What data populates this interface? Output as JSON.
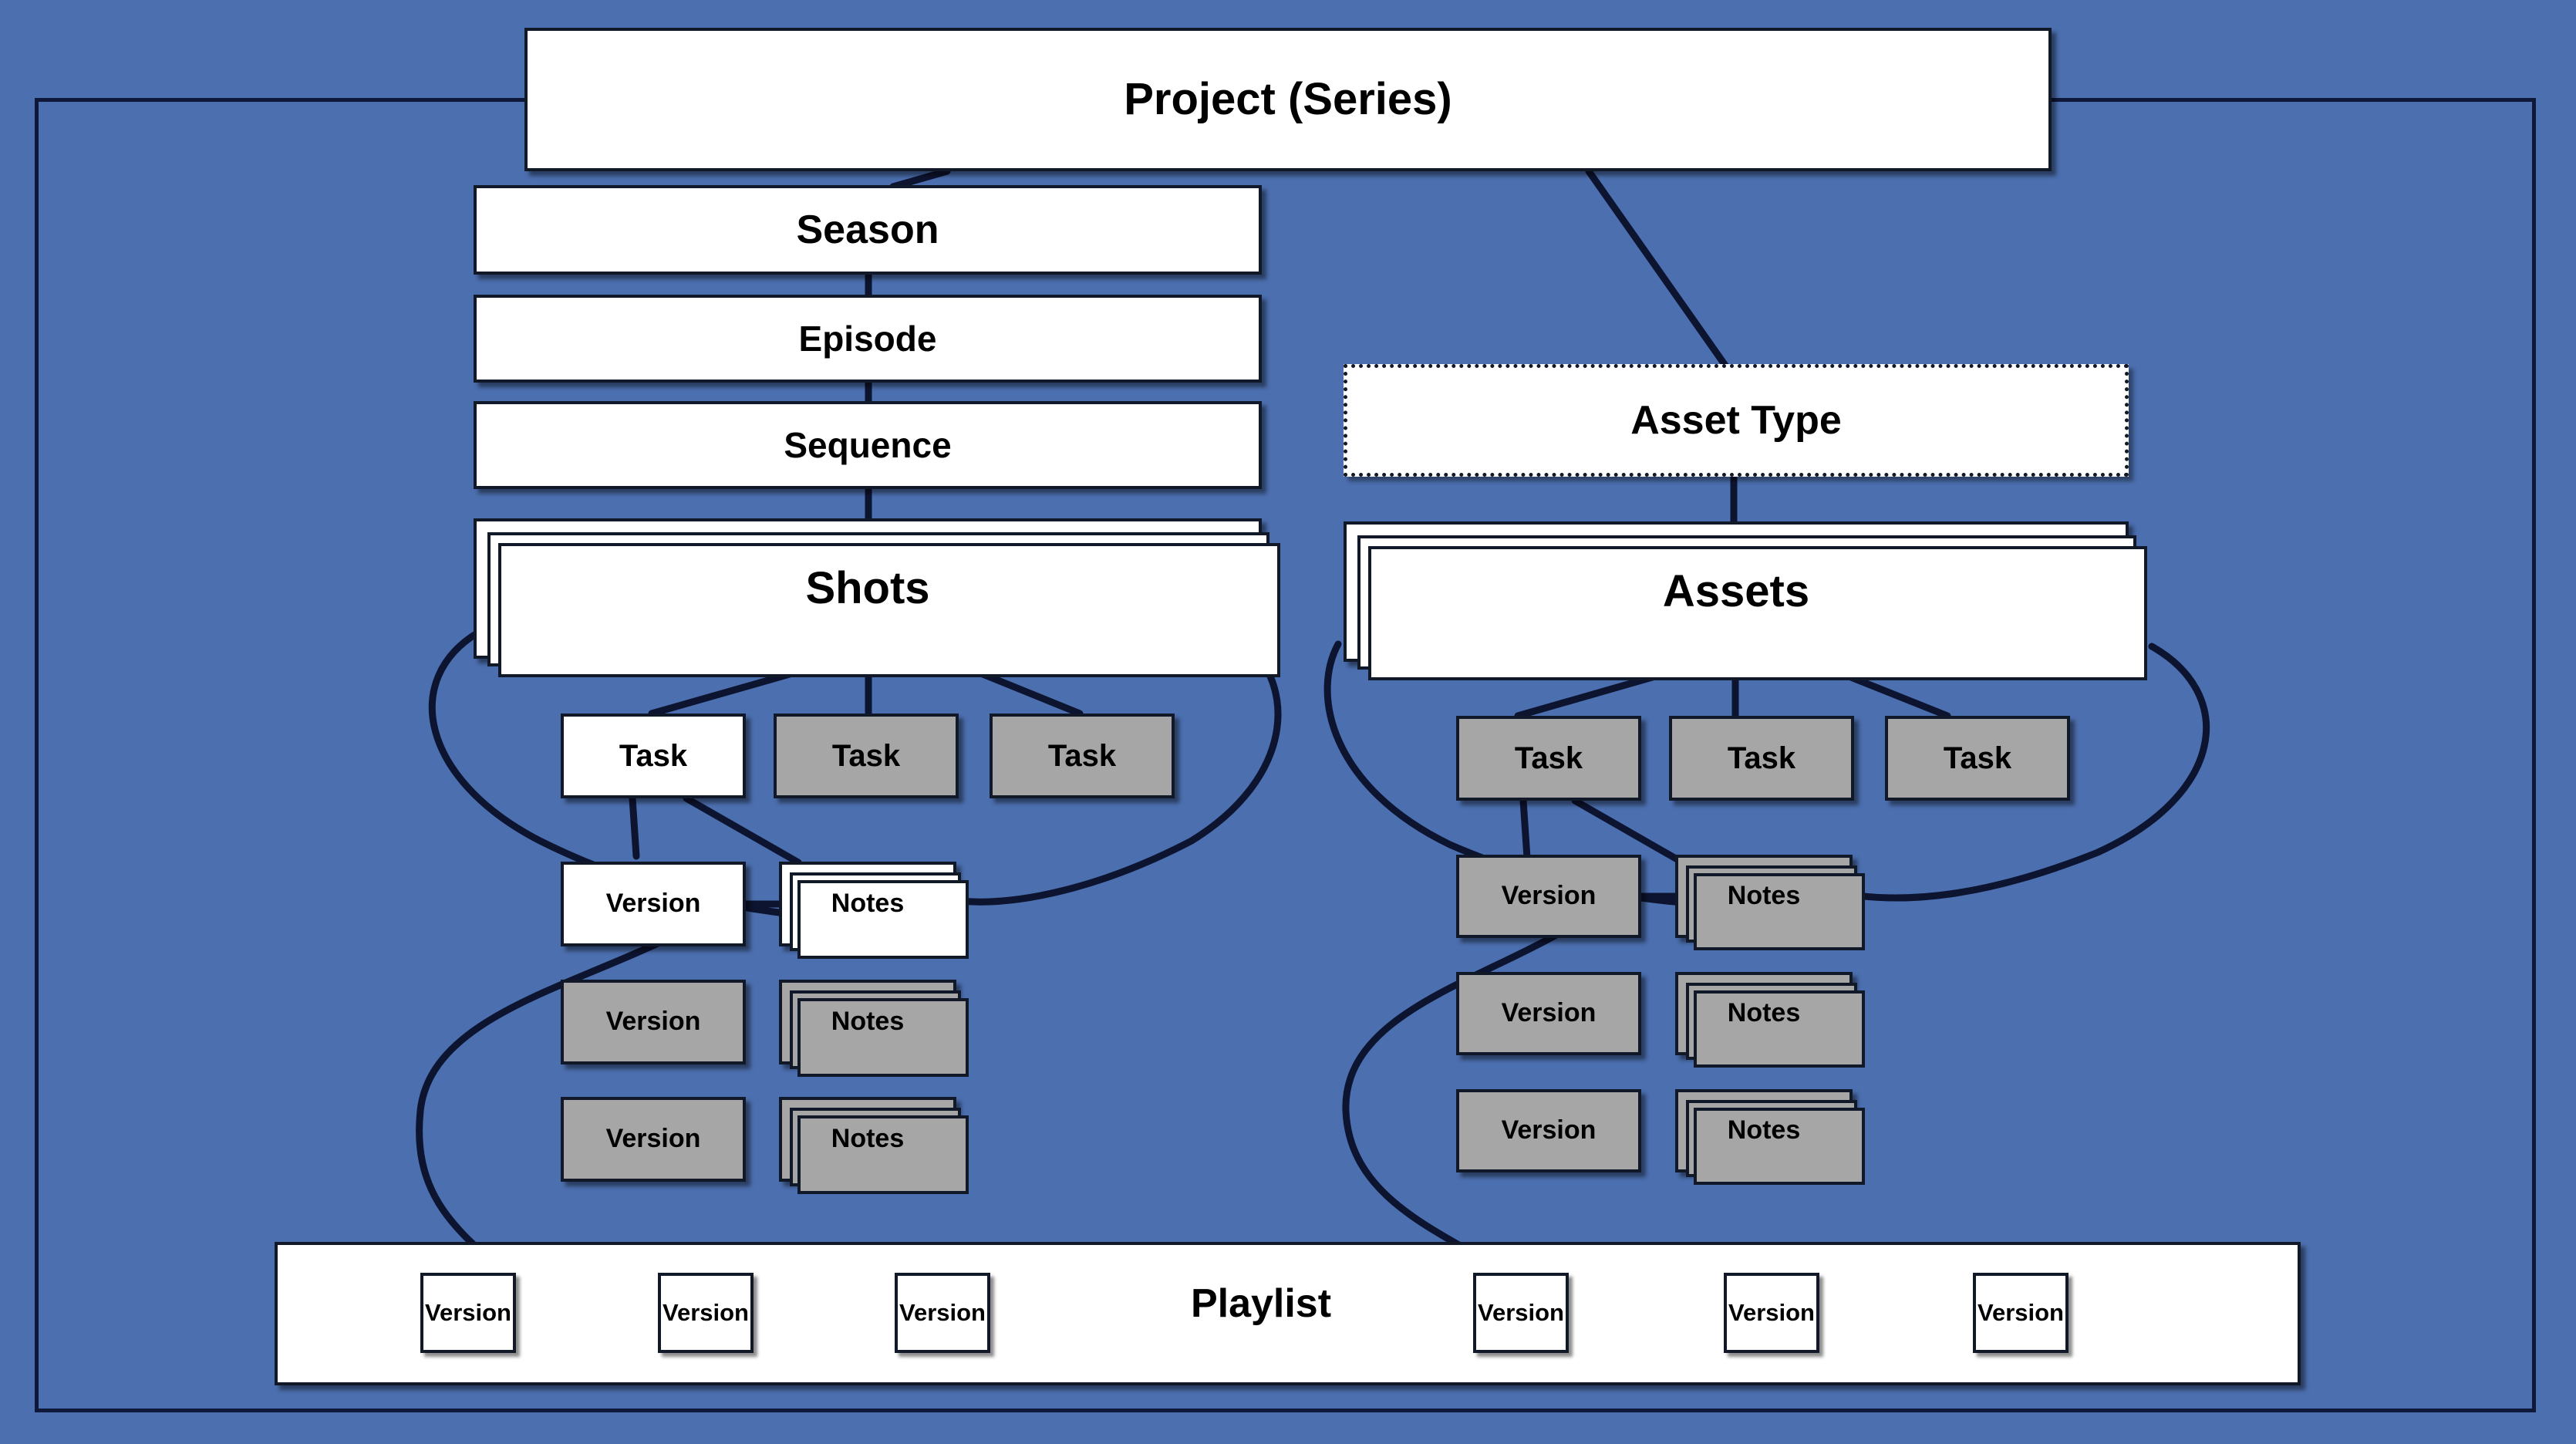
{
  "diagram": {
    "title": "Project hierarchy diagram",
    "background_color": "#4C6FAF",
    "node_fill_white": "#FFFFFF",
    "node_fill_gray": "#A6A6A6",
    "node_border_color": "#111827"
  },
  "nodes": {
    "project": {
      "label": "Project (Series)"
    },
    "season": {
      "label": "Season"
    },
    "episode": {
      "label": "Episode"
    },
    "sequence": {
      "label": "Sequence"
    },
    "shots": {
      "label": "Shots"
    },
    "asset_type": {
      "label": "Asset Type"
    },
    "assets": {
      "label": "Assets"
    }
  },
  "shots_branch": {
    "tasks": [
      {
        "label": "Task",
        "fill": "white"
      },
      {
        "label": "Task",
        "fill": "gray"
      },
      {
        "label": "Task",
        "fill": "gray"
      }
    ],
    "versions": [
      {
        "label": "Version",
        "fill": "white"
      },
      {
        "label": "Version",
        "fill": "gray"
      },
      {
        "label": "Version",
        "fill": "gray"
      }
    ],
    "notes": [
      {
        "label": "Notes",
        "fill": "white"
      },
      {
        "label": "Notes",
        "fill": "gray"
      },
      {
        "label": "Notes",
        "fill": "gray"
      }
    ]
  },
  "assets_branch": {
    "tasks": [
      {
        "label": "Task",
        "fill": "gray"
      },
      {
        "label": "Task",
        "fill": "gray"
      },
      {
        "label": "Task",
        "fill": "gray"
      }
    ],
    "versions": [
      {
        "label": "Version",
        "fill": "gray"
      },
      {
        "label": "Version",
        "fill": "gray"
      },
      {
        "label": "Version",
        "fill": "gray"
      }
    ],
    "notes": [
      {
        "label": "Notes",
        "fill": "gray"
      },
      {
        "label": "Notes",
        "fill": "gray"
      },
      {
        "label": "Notes",
        "fill": "gray"
      }
    ]
  },
  "playlist": {
    "label": "Playlist",
    "versions_left": [
      {
        "label": "Version"
      },
      {
        "label": "Version"
      },
      {
        "label": "Version"
      }
    ],
    "versions_right": [
      {
        "label": "Version"
      },
      {
        "label": "Version"
      },
      {
        "label": "Version"
      }
    ]
  }
}
